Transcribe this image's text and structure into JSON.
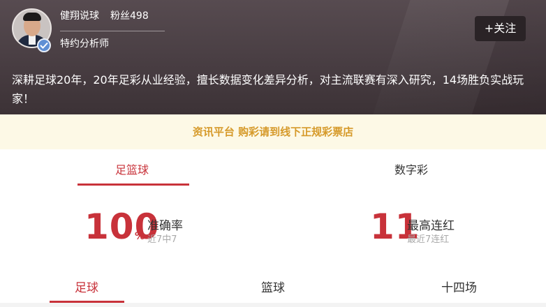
{
  "profile": {
    "name": "健翔说球",
    "fans": "粉丝498",
    "role": "特约分析师",
    "follow_label": "+关注",
    "intro": "深耕足球20年，20年足彩从业经验，擅长数据变化差异分析，对主流联赛有深入研究，14场胜负实战玩家！"
  },
  "notice": {
    "text": "资讯平台 购彩请到线下正规彩票店"
  },
  "top_tabs": [
    {
      "label": "足篮球",
      "active": true
    },
    {
      "label": "数字彩",
      "active": false
    }
  ],
  "stats": {
    "accuracy": {
      "value": "100",
      "unit": "%",
      "label": "准确率",
      "sub": "近7中7"
    },
    "streak": {
      "value": "11",
      "label": "最高连红",
      "sub": "最近7连红"
    }
  },
  "bottom_tabs": [
    {
      "label": "足球",
      "active": true
    },
    {
      "label": "篮球",
      "active": false
    },
    {
      "label": "十四场",
      "active": false
    }
  ],
  "colors": {
    "accent": "#c8323a",
    "header_bg": "#4b4045",
    "notice_bg": "#fdf9e6",
    "notice_text": "#d69a2a",
    "verify_badge": "#5f8fd4"
  }
}
